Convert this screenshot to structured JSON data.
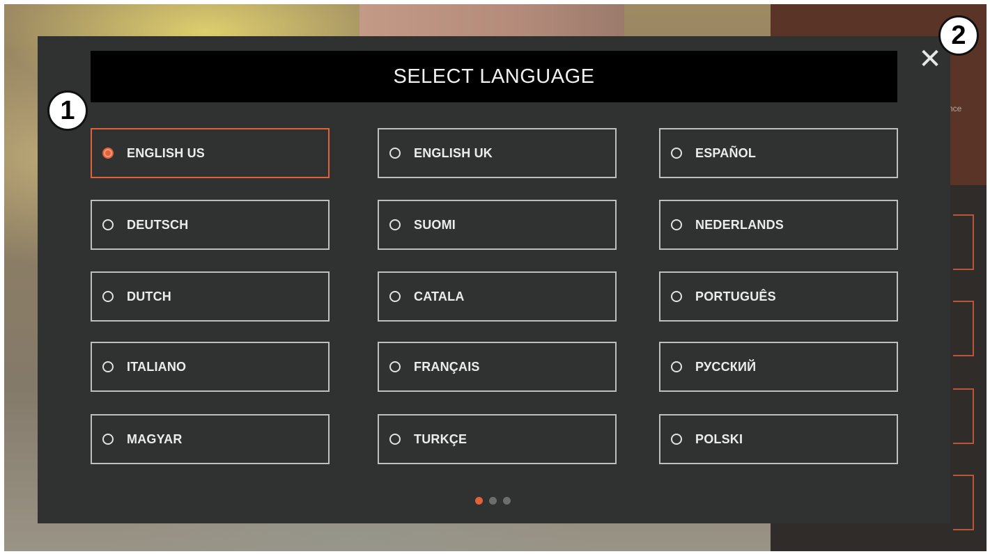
{
  "dialog": {
    "title": "SELECT LANGUAGE",
    "close_glyph": "✕"
  },
  "languages": [
    {
      "label": "ENGLISH US",
      "selected": true
    },
    {
      "label": "ENGLISH UK",
      "selected": false
    },
    {
      "label": "ESPAÑOL",
      "selected": false
    },
    {
      "label": "DEUTSCH",
      "selected": false
    },
    {
      "label": "SUOMI",
      "selected": false
    },
    {
      "label": "NEDERLANDS",
      "selected": false
    },
    {
      "label": "DUTCH",
      "selected": false
    },
    {
      "label": "CATALA",
      "selected": false
    },
    {
      "label": "PORTUGUÊS",
      "selected": false
    },
    {
      "label": "ITALIANO",
      "selected": false
    },
    {
      "label": "FRANÇAIS",
      "selected": false
    },
    {
      "label": "РУССКИЙ",
      "selected": false
    },
    {
      "label": "MAGYAR",
      "selected": false
    },
    {
      "label": "TURKÇE",
      "selected": false
    },
    {
      "label": "POLSKI",
      "selected": false
    }
  ],
  "pagination": {
    "pages": 3,
    "current": 1
  },
  "background": {
    "hint_text": "nce"
  },
  "callouts": {
    "one": "1",
    "two": "2"
  },
  "colors": {
    "accent": "#e0623a",
    "modal_bg": "#303231",
    "header_bg": "#000000",
    "border": "#bfbfbf"
  },
  "icons": {
    "close": "close-icon",
    "radio": "radio-icon"
  }
}
